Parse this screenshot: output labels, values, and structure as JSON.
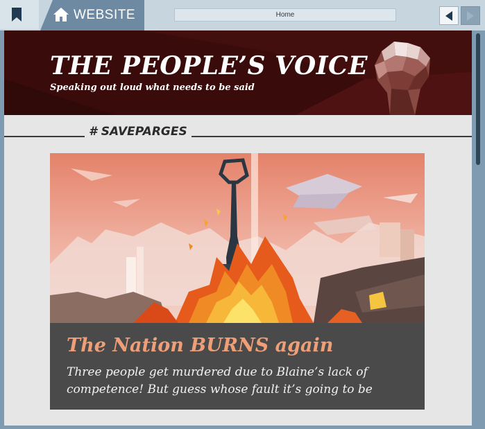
{
  "browser": {
    "tab_label": "WEBSITE",
    "address": "Home",
    "icons": [
      "bookmark-icon",
      "home-icon",
      "back-arrow-icon",
      "forward-arrow-icon"
    ]
  },
  "site": {
    "title": "THE PEOPLE’S VOICE",
    "tagline": "Speaking out loud what needs to be said",
    "logo_icon": "raised-fist-icon"
  },
  "hashtag": "# SAVEPARGES",
  "article": {
    "image": "burning-monument-illustration",
    "headline": "The Nation BURNS again",
    "summary": "Three people get murdered due to Blaine’s lack of competence! But guess whose fault it’s going to be"
  },
  "colors": {
    "chrome": "#7f9bb2",
    "banner": "#3a0b0b",
    "headline": "#ef9f78",
    "card": "#4a4a4a",
    "page": "#e6e6e6"
  }
}
